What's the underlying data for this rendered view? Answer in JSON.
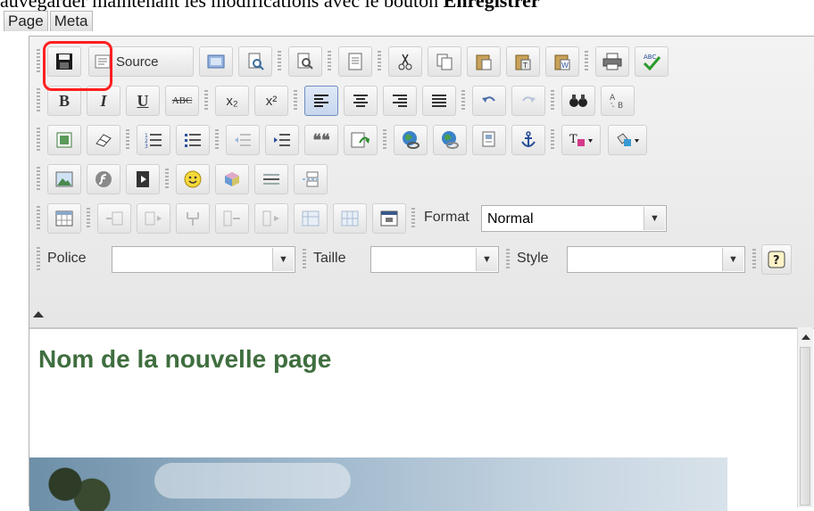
{
  "instruction_text": {
    "prefix": "auvegarder maintenant les modifications avec le bouton ",
    "emphasis": "Enregistrer"
  },
  "tabs": [
    {
      "label": "Page"
    },
    {
      "label": "Meta"
    }
  ],
  "toolbar": {
    "source_label": "Source",
    "format_label": "Format",
    "format_value": "Normal",
    "police_label": "Police",
    "police_value": "",
    "taille_label": "Taille",
    "taille_value": "",
    "style_label": "Style",
    "style_value": "",
    "bold": "B",
    "italic": "I",
    "underline": "U",
    "strike": "ABC",
    "subscript": "x₂",
    "superscript": "x²",
    "quote_glyph": "❝❝"
  },
  "content": {
    "heading": "Nom de la nouvelle page"
  },
  "colors": {
    "highlight": "#ff1f1f",
    "heading": "#3f6e3f"
  }
}
